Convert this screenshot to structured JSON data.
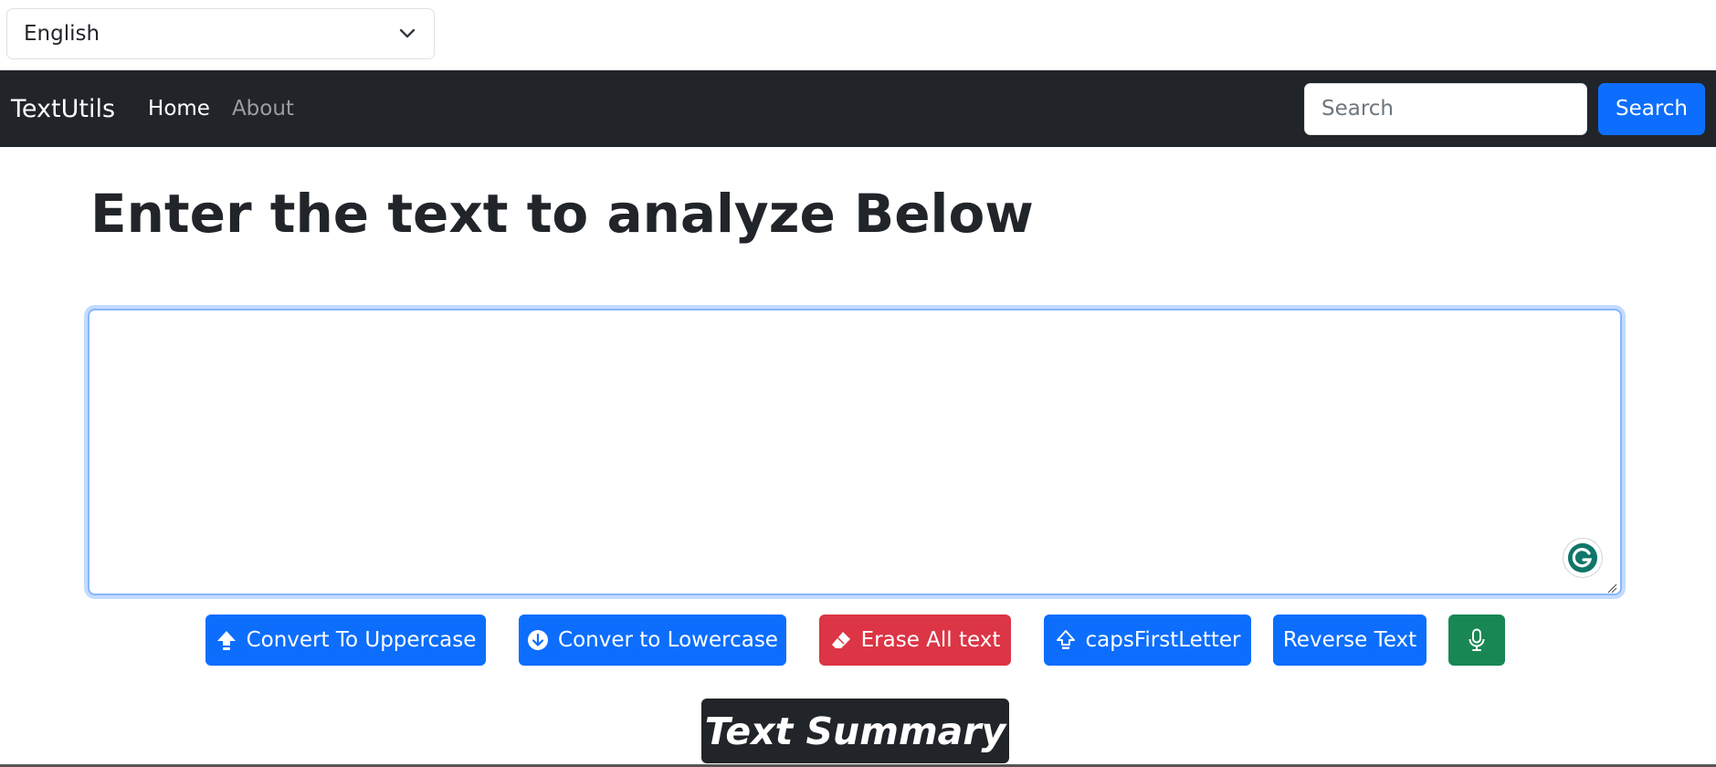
{
  "language_select": {
    "selected": "English"
  },
  "navbar": {
    "brand": "TextUtils",
    "links": [
      {
        "label": "Home",
        "active": true
      },
      {
        "label": "About",
        "active": false
      }
    ],
    "search": {
      "placeholder": "Search",
      "value": "",
      "button_label": "Search"
    }
  },
  "main": {
    "heading": "Enter the text to analyze Below",
    "textarea": {
      "value": "",
      "placeholder": ""
    },
    "buttons": {
      "uppercase": {
        "label": "Convert To Uppercase",
        "icon": "arrow-up-icon",
        "color": "#0d6efd"
      },
      "lowercase": {
        "label": "Conver to Lowercase",
        "icon": "arrow-down-circle-icon",
        "color": "#0d6efd"
      },
      "erase": {
        "label": "Erase All text",
        "icon": "eraser-icon",
        "color": "#dc3545"
      },
      "caps_first": {
        "label": "capsFirstLetter",
        "icon": "arrow-up-outline-icon",
        "color": "#0d6efd"
      },
      "reverse": {
        "label": "Reverse Text",
        "color": "#0d6efd"
      },
      "mic": {
        "icon": "microphone-icon",
        "color": "#198754"
      }
    },
    "summary_heading": "Text Summary"
  },
  "colors": {
    "navbar_bg": "#212529",
    "primary": "#0d6efd",
    "danger": "#dc3545",
    "success": "#198754",
    "focus_border": "#86b7fe"
  }
}
